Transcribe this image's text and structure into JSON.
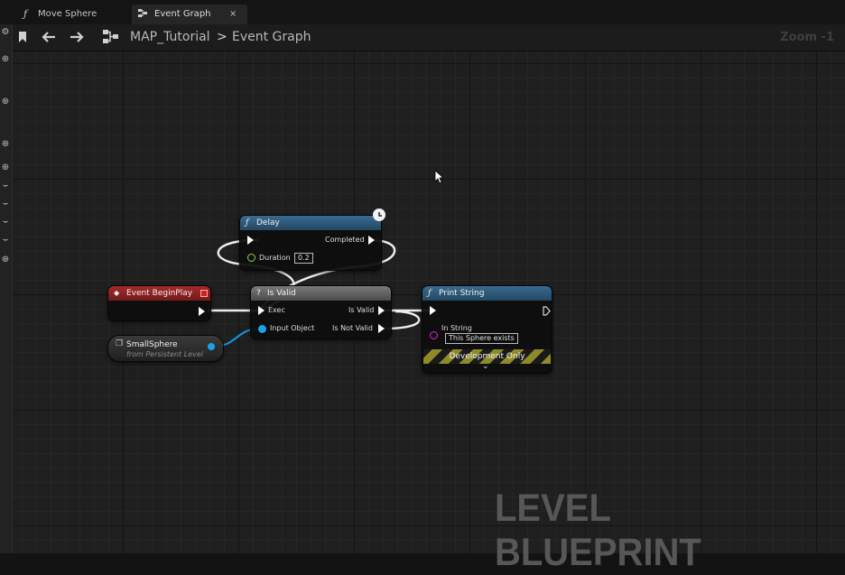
{
  "tabs": [
    {
      "label": "Move Sphere",
      "icon": "function-icon"
    },
    {
      "label": "Event Graph",
      "icon": "graph-icon",
      "close": "×"
    }
  ],
  "breadcrumb": {
    "level": "MAP_Tutorial",
    "separator": ">",
    "graph": "Event Graph"
  },
  "zoom_label": "Zoom -1",
  "nodes": {
    "delay": {
      "title": "Delay",
      "completed": "Completed",
      "duration_label": "Duration",
      "duration_value": "0.2"
    },
    "begin_play": {
      "title": "Event BeginPlay"
    },
    "is_valid": {
      "title": "Is Valid",
      "exec": "Exec",
      "input_object": "Input Object",
      "is_valid": "Is Valid",
      "is_not_valid": "Is Not Valid"
    },
    "small_sphere": {
      "title": "SmallSphere",
      "subtitle": "from Persistent Level"
    },
    "print_string": {
      "title": "Print String",
      "in_string_label": "In String",
      "in_string_value": "This Sphere exists",
      "footer": "Development Only"
    }
  },
  "watermark": "LEVEL BLUEPRINT",
  "colors": {
    "delay_header": "#2f5877",
    "begin_play_header": "#8c1f1f",
    "is_valid_header": "#6a6a6a",
    "print_header": "#2f5877",
    "object_pin": "#1aa3e8",
    "string_pin": "#e020d8"
  }
}
